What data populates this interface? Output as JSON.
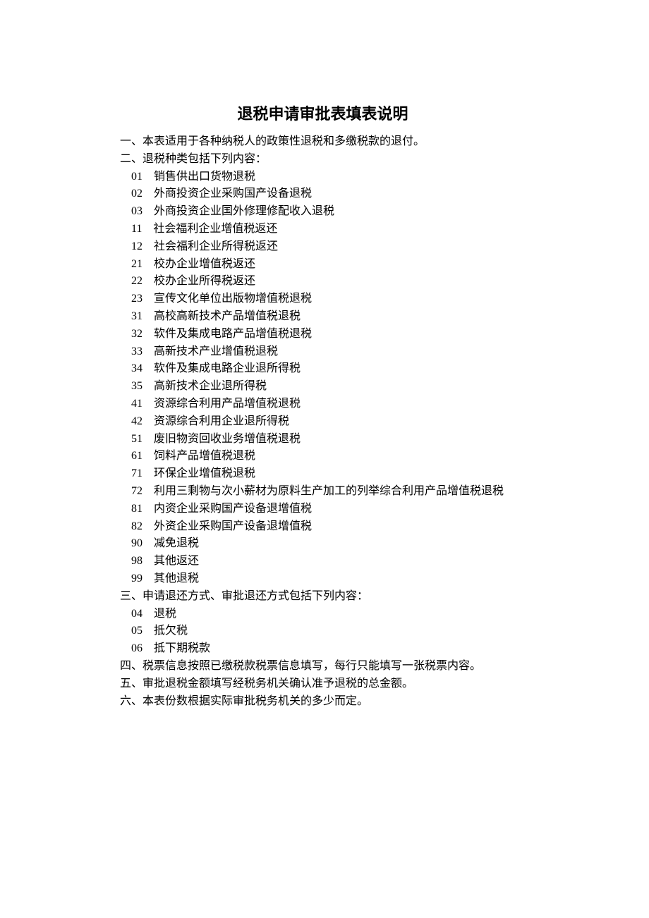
{
  "title": "退税申请审批表填表说明",
  "paragraph1": "一、本表适用于各种纳税人的政策性退税和多缴税款的退付。",
  "paragraph2_head": "二、退税种类包括下列内容：",
  "codes_section2": [
    {
      "code": "01",
      "desc": "销售供出口货物退税"
    },
    {
      "code": "02",
      "desc": "外商投资企业采购国产设备退税"
    },
    {
      "code": "03",
      "desc": "外商投资企业国外修理修配收入退税"
    },
    {
      "code": "11",
      "desc": "社会福利企业增值税返还"
    },
    {
      "code": "12",
      "desc": "社会福利企业所得税返还"
    },
    {
      "code": "21",
      "desc": "校办企业增值税返还"
    },
    {
      "code": "22",
      "desc": "校办企业所得税返还"
    },
    {
      "code": "23",
      "desc": "宣传文化单位出版物增值税退税"
    },
    {
      "code": "31",
      "desc": "高校高新技术产品增值税退税"
    },
    {
      "code": "32",
      "desc": "软件及集成电路产品增值税退税"
    },
    {
      "code": "33",
      "desc": "高新技术产业增值税退税"
    },
    {
      "code": "34",
      "desc": "软件及集成电路企业退所得税"
    },
    {
      "code": "35",
      "desc": "高新技术企业退所得税"
    },
    {
      "code": "41",
      "desc": "资源综合利用产品增值税退税"
    },
    {
      "code": "42",
      "desc": "资源综合利用企业退所得税"
    },
    {
      "code": "51",
      "desc": "废旧物资回收业务增值税退税"
    },
    {
      "code": "61",
      "desc": "饲料产品增值税退税"
    },
    {
      "code": "71",
      "desc": "环保企业增值税退税"
    },
    {
      "code": "72",
      "desc": "利用三剩物与次小薪材为原料生产加工的列举综合利用产品增值税退税"
    },
    {
      "code": "81",
      "desc": "内资企业采购国产设备退增值税"
    },
    {
      "code": "82",
      "desc": "外资企业采购国产设备退增值税"
    },
    {
      "code": "90",
      "desc": "减免退税"
    },
    {
      "code": "98",
      "desc": "其他返还"
    },
    {
      "code": "99",
      "desc": "其他退税"
    }
  ],
  "paragraph3_head": "三、申请退还方式、审批退还方式包括下列内容：",
  "codes_section3": [
    {
      "code": "04",
      "desc": "退税"
    },
    {
      "code": "05",
      "desc": "抵欠税"
    },
    {
      "code": "06",
      "desc": "抵下期税款"
    }
  ],
  "paragraph4": "四、税票信息按照已缴税款税票信息填写，每行只能填写一张税票内容。",
  "paragraph5": "五、审批退税金额填写经税务机关确认准予退税的总金额。",
  "paragraph6": "六、本表份数根据实际审批税务机关的多少而定。"
}
